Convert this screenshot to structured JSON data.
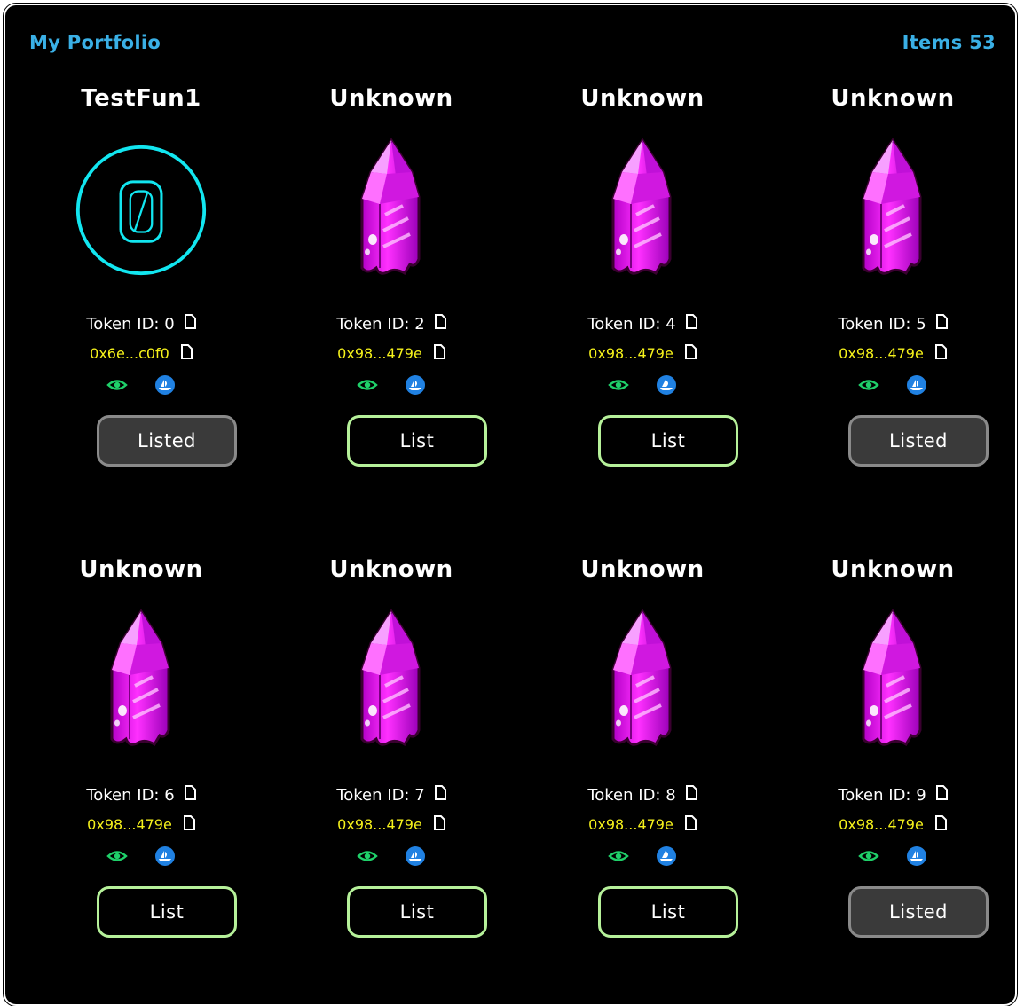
{
  "header": {
    "title": "My Portfolio",
    "items_label": "Items 53"
  },
  "colors": {
    "accent": "#3ab0e6",
    "address": "#f6f21b",
    "list_border": "#b6f19a",
    "listed_bg": "#3a3a3a",
    "crystal": "#ff20ff",
    "ring": "#12e6f0"
  },
  "cards": [
    {
      "name": "TestFun1",
      "token": "Token ID: 0",
      "address": "0x6e...c0f0",
      "button": "Listed",
      "image": "ring-token-icon"
    },
    {
      "name": "Unknown",
      "token": "Token ID: 2",
      "address": "0x98...479e",
      "button": "List",
      "image": "crystal-icon"
    },
    {
      "name": "Unknown",
      "token": "Token ID: 4",
      "address": "0x98...479e",
      "button": "List",
      "image": "crystal-icon"
    },
    {
      "name": "Unknown",
      "token": "Token ID: 5",
      "address": "0x98...479e",
      "button": "Listed",
      "image": "crystal-icon"
    },
    {
      "name": "Unknown",
      "token": "Token ID: 6",
      "address": "0x98...479e",
      "button": "List",
      "image": "crystal-icon"
    },
    {
      "name": "Unknown",
      "token": "Token ID: 7",
      "address": "0x98...479e",
      "button": "List",
      "image": "crystal-icon"
    },
    {
      "name": "Unknown",
      "token": "Token ID: 8",
      "address": "0x98...479e",
      "button": "List",
      "image": "crystal-icon"
    },
    {
      "name": "Unknown",
      "token": "Token ID: 9",
      "address": "0x98...479e",
      "button": "Listed",
      "image": "crystal-icon"
    }
  ]
}
